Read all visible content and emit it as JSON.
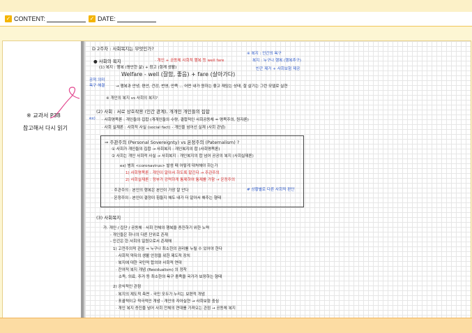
{
  "header": {
    "content_label": "CONTENT:",
    "date_label": "DATE:"
  },
  "sidenote": {
    "line1": "※ 교과서 P38",
    "line2": "참고해서 다시 읽기"
  },
  "page_title": "D 2주차 : 사회복지는 무엇인가?",
  "sections": {
    "s1_title": "● 사회의 복지",
    "s1_l1": "(1) 복지 : 행복 (평안한 삶) + 참고 (함께 생활)",
    "s1_l2": "Welfare - well (잘함, 좋음) + fare (살아가다)",
    "s1_l3": "→ 행복과 안녕, 편안, 건강, 번영, 만족 ... 어떤 내가 원하는 좋고 재밌는 상태, 잘 살기는 그런 모델로 실현",
    "s1_l4": "※ 개인의 복지 vs 사회의 복지?",
    "s2_title": "(2) 사회 : 서로 상호작용 (인간 관계), 개개인 개인들의 집합",
    "s2_l1": "· 사회명목론 : 개인들의 집합 (개개인들의 수량, 결합적인 사회공동체 = 명목주의, 원자론)",
    "s2_l2": "· 사회 실재론 : 사회적 사실 (social fact) - 개인을 넘어선 실재 (사회 관념)",
    "box_l1": "⇒ 주관주의 (Personal Sovereignty)  vs  온정주의 (Paternalism) ?",
    "box_l2": "① 사회가 개인들의 집합 → 사회복지 : 개인복지의 합 (사회명목론)",
    "box_l3": "② 사회는 개인 사회적 사실 → 사회복지 : 개인복지의 합 넘어 공공의 복지 (사회실재론)",
    "box_l4": "ex) 범죄 <coronavirus> 발생 때 어떻게 대처해야 하는가",
    "box_l5": "1) 사회명목론 : 개인이 알아서 하도록 맡긴다 → 주관주의",
    "box_l6": "2) 사회실재론 : 정부가 강력하게 통제하여 통제를 가함 → 온정주의",
    "box_l7": "· 주관주의 : 본인의 행복은 본인이 가장 잘 안다",
    "box_l8": "· 온정주의 : 본인이 결정이 힘들지 해도 내가 더 알아서 해주는 형태",
    "box_note": "# 상황별로 다른 사회적 판단",
    "s3_title": "(3) 사회복지",
    "s3_l1": "가. 개인 / 집단 / 공동체 · 사회 전체의 행복을 증진하기 위한 노력",
    "s3_l2": "- 개인들은 하나의 다른 단위로 존재",
    "s3_l3": "- 인간은 한 사회의 일원으로서 존재해",
    "s3_l4": "1) 고전주의적 관점 ⇒ 누구나 최소한의 권리를 누릴 수 있어야 한다",
    "s3_l5": "· 사회적 약자의 생활 안정을 위한 제도적 장치",
    "s3_l6": "· 복지에 대한 국민적 합의와 사회적 연대",
    "s3_l7": "· 잔여적 복지 개념 (Residualism) 의 정착",
    "s3_l8": "  소득, 의료, 주거 등 최소한의 욕구 충족을 국가가 보장하는 형태",
    "s3_l9": "2) 공식적인 관점",
    "s3_l10": "· 복지의 제도적 측면 - 국민 모두가 누리는 보편적 개념",
    "s3_l11": "· 포괄적이고 적극적인 개념 - 개인의 자아실현 → 사회보험 중심",
    "s3_l12": "· 개인 복지 증진을 넘어 사회 전체의 연대를 가져오는 관점 → 공동체 복지"
  },
  "annotations": {
    "red1": "· 개인 + 공동체 사회적 행복 등 well fare",
    "blue1": "※ 복지 : 인간의 욕구",
    "blue2": "복지 : 누구나 행복 (행복추구)",
    "blue3": "빈곤 제거 + 사회보험 제공",
    "blue4": "공적 의미",
    "blue5": "욕구 해결",
    "red2": "의미",
    "red3": "ex)"
  }
}
